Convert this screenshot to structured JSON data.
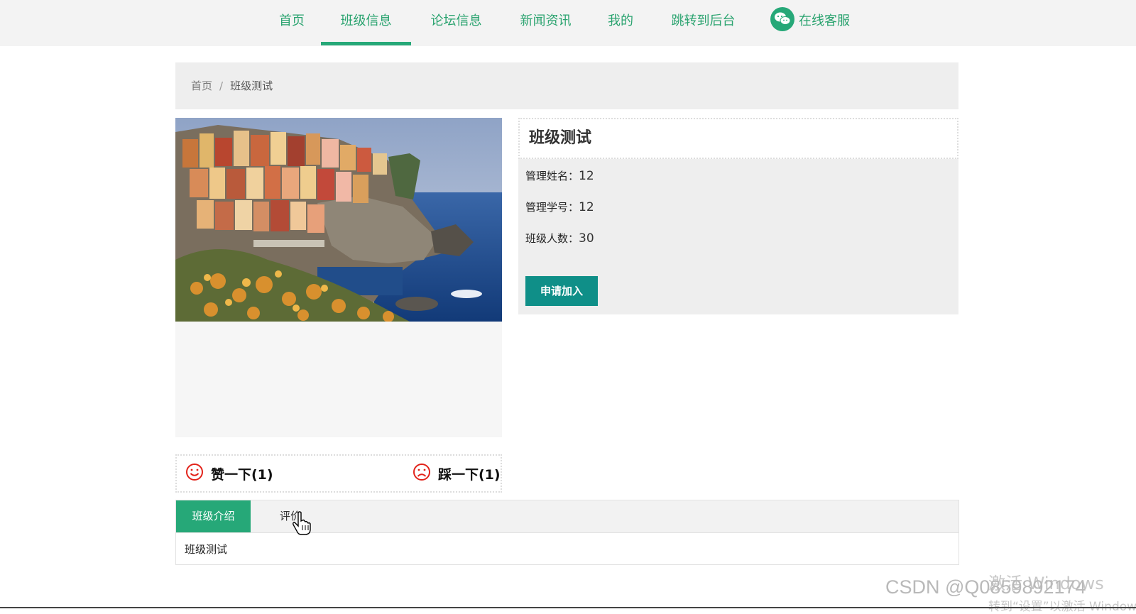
{
  "nav": {
    "items": [
      "首页",
      "班级信息",
      "论坛信息",
      "新闻资讯",
      "我的",
      "跳转到后台"
    ],
    "active_index": 1,
    "customer_service": "在线客服",
    "accent_color": "#26a878"
  },
  "breadcrumb": {
    "home": "首页",
    "separator": "/",
    "current": "班级测试"
  },
  "detail": {
    "title": "班级测试",
    "fields": [
      {
        "label": "管理姓名：",
        "value": "12"
      },
      {
        "label": "管理学号：",
        "value": "12"
      },
      {
        "label": "班级人数：",
        "value": "30"
      }
    ],
    "join_button": "申请加入",
    "button_color": "#0f8f88"
  },
  "vote": {
    "like": "赞一下(1)",
    "dislike": "踩一下(1)",
    "icon_color": "#e2231a"
  },
  "tabs": {
    "items": [
      "班级介绍",
      "评价"
    ],
    "active_index": 0,
    "content": "班级测试"
  },
  "watermarks": {
    "windows_line1": "激活 Windows",
    "windows_line2": "转到“设置”以激活 Windows。",
    "csdn": "CSDN @Q0859892174"
  },
  "icons": {
    "customer_service": "wechat-icon",
    "like": "smile-icon",
    "dislike": "frown-icon",
    "cursor": "hand-cursor-icon"
  }
}
